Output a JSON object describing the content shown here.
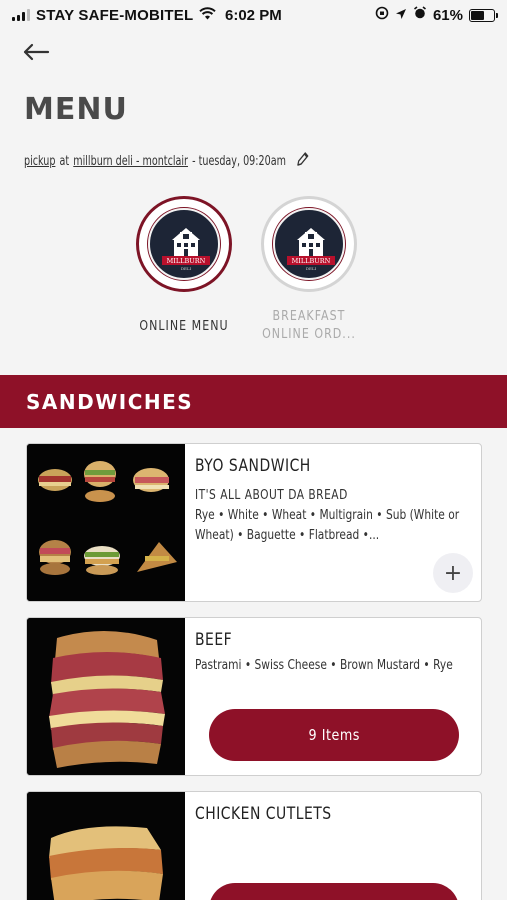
{
  "status_bar": {
    "carrier": "STAY SAFE-MOBITEL",
    "time": "6:02 PM",
    "battery": "61%",
    "battery_level": 0.61
  },
  "page": {
    "title": "MENU",
    "order": {
      "mode": "pickup",
      "at": "at",
      "location": "millburn deli - montclair",
      "when": "- tuesday, 09:20am"
    }
  },
  "menus": [
    {
      "label": "ONLINE MENU",
      "logo_text": "MILLBURN",
      "logo_sub": "DELI",
      "selected": true
    },
    {
      "label_line1": "BREAKFAST",
      "label_line2": "ONLINE ORD...",
      "logo_text": "MILLBURN",
      "logo_sub": "DELI",
      "selected": false
    }
  ],
  "section": {
    "title": "SANDWICHES"
  },
  "items": [
    {
      "name": "BYO SANDWICH",
      "subtitle": "IT'S ALL ABOUT DA BREAD",
      "description": "Rye • White • Wheat • Multigrain • Sub (White or Wheat) • Baguette • Flatbread •...",
      "action": "+"
    },
    {
      "name": "BEEF",
      "description": "Pastrami • Swiss Cheese • Brown Mustard • Rye",
      "action": "9 Items"
    },
    {
      "name": "CHICKEN CUTLETS",
      "description": ""
    }
  ],
  "colors": {
    "brand": "#8e1128",
    "background": "#f4f4f4"
  }
}
